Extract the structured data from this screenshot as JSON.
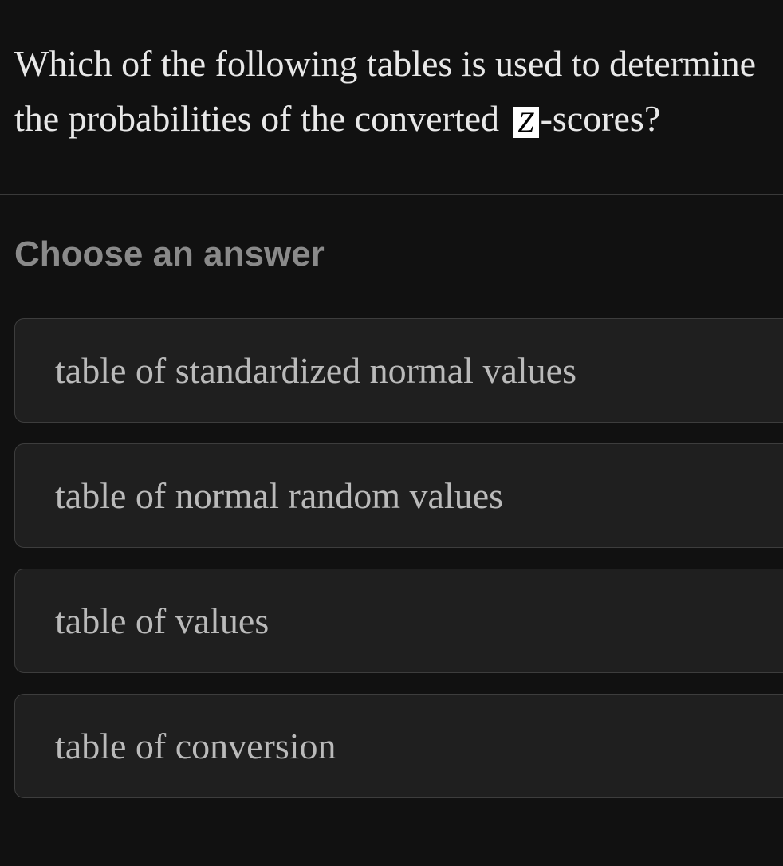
{
  "question": {
    "text_before": "Which of the following tables is used to determine the probabilities of the converted ",
    "badge": "Z",
    "text_after": "-scores?"
  },
  "choose_label": "Choose an answer",
  "answers": [
    {
      "label": "table of standardized normal values"
    },
    {
      "label": "table of normal random values"
    },
    {
      "label": "table of values"
    },
    {
      "label": "table of conversion"
    }
  ]
}
